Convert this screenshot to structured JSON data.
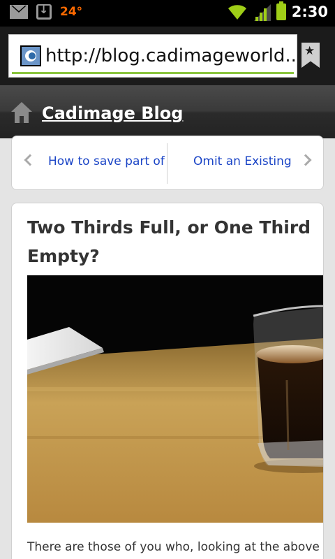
{
  "status_bar": {
    "temperature": "24°",
    "time": "2:30",
    "icons": [
      "mail-icon",
      "download-icon",
      "wifi-icon",
      "signal-icon",
      "battery-icon"
    ]
  },
  "browser": {
    "url": "http://blog.cadimageworld...."
  },
  "blog": {
    "title": "Cadimage Blog"
  },
  "post_nav": {
    "prev_label": "How to save part of",
    "next_label": "Omit an Existing"
  },
  "post": {
    "title": "Two Thirds Full, or One Third Empty?",
    "excerpt": "There are those of you who, looking at the above"
  },
  "colors": {
    "accent_green": "#8bc53f",
    "link_blue": "#1a44c6",
    "temperature_orange": "#ff6a00"
  }
}
